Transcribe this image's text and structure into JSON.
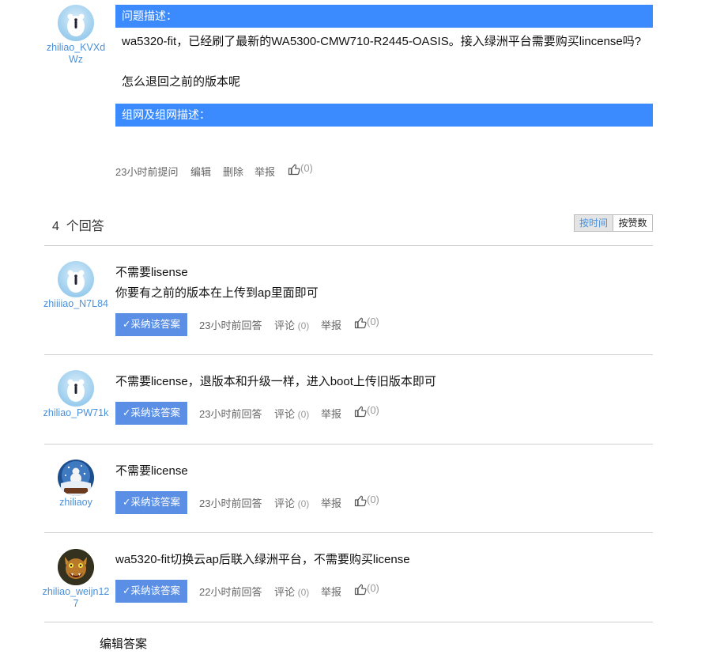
{
  "question": {
    "author": "zhiliao_KVXdWz",
    "problem_header": "问题描述：",
    "problem_lines": [
      "wa5320-fit，已经刷了最新的WA5300-CMW710-R2445-OASIS。接入绿洲平台需要购买lincense吗?",
      "怎么退回之前的版本呢"
    ],
    "network_header": "组网及组网描述：",
    "meta": {
      "time": "23小时前提问",
      "edit": "编辑",
      "delete": "删除",
      "report": "举报",
      "like_count": "(0)"
    }
  },
  "answers_header": {
    "count": "4",
    "label": "个回答",
    "sort_time": "按时间",
    "sort_likes": "按赞数"
  },
  "answers": [
    {
      "author": "zhiiiiao_N7L84",
      "lines": [
        "不需要lisense",
        "你要有之前的版本在上传到ap里面即可"
      ],
      "adopt": "✓采纳该答案",
      "time": "23小时前回答",
      "comment": "评论",
      "comment_count": "(0)",
      "report": "举报",
      "like_count": "(0)"
    },
    {
      "author": "zhiliao_PW71k",
      "lines": [
        "不需要license，退版本和升级一样，进入boot上传旧版本即可"
      ],
      "adopt": "✓采纳该答案",
      "time": "23小时前回答",
      "comment": "评论",
      "comment_count": "(0)",
      "report": "举报",
      "like_count": "(0)"
    },
    {
      "author": "zhiliaoy",
      "lines": [
        "不需要license"
      ],
      "adopt": "✓采纳该答案",
      "time": "23小时前回答",
      "comment": "评论",
      "comment_count": "(0)",
      "report": "举报",
      "like_count": "(0)"
    },
    {
      "author": "zhiliao_weijn127",
      "lines": [
        "wa5320-fit切换云ap后联入绿洲平台，不需要购买license"
      ],
      "adopt": "✓采纳该答案",
      "time": "22小时前回答",
      "comment": "评论",
      "comment_count": "(0)",
      "report": "举报",
      "like_count": "(0)"
    }
  ],
  "edit_answer": "编辑答案",
  "colors": {
    "accent_bar": "#3b8bff",
    "adopt_button": "#5b8fe6",
    "username": "#4a90d9"
  },
  "icons": {
    "like": "thumbs-up-icon",
    "avatar_default": "polar-bear-avatar"
  }
}
